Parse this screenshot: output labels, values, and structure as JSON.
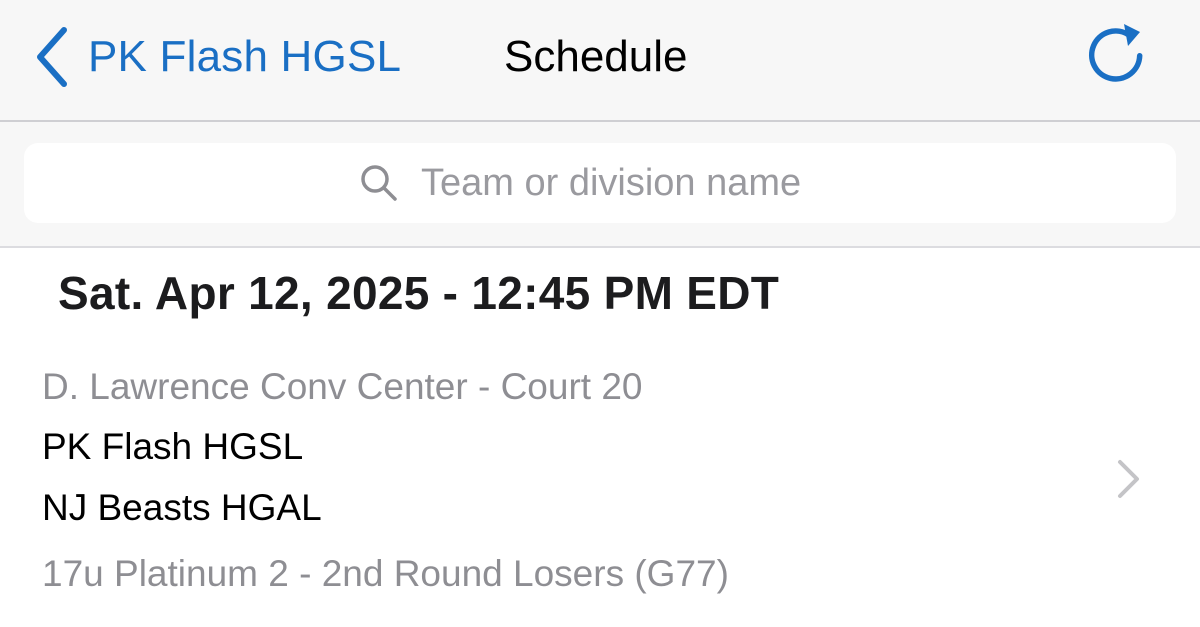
{
  "colors": {
    "accent": "#1a6fc4",
    "nav_background": "#f7f7f7",
    "secondary_text": "#8e8e93",
    "chevron": "#c4c4c7"
  },
  "navbar": {
    "back_label": "PK Flash HGSL",
    "title": "Schedule",
    "back_icon": "chevron-left-icon",
    "refresh_icon": "refresh-icon"
  },
  "search": {
    "placeholder": "Team or division name",
    "value": "",
    "icon": "search-icon"
  },
  "schedule": {
    "date_header": "Sat. Apr 12, 2025 - 12:45 PM EDT",
    "games": [
      {
        "venue": "D. Lawrence Conv Center - Court 20",
        "team1": "PK Flash HGSL",
        "team2": "NJ Beasts HGAL",
        "division": "17u Platinum 2 - 2nd Round Losers (G77)",
        "chevron_icon": "chevron-right-icon"
      }
    ]
  }
}
